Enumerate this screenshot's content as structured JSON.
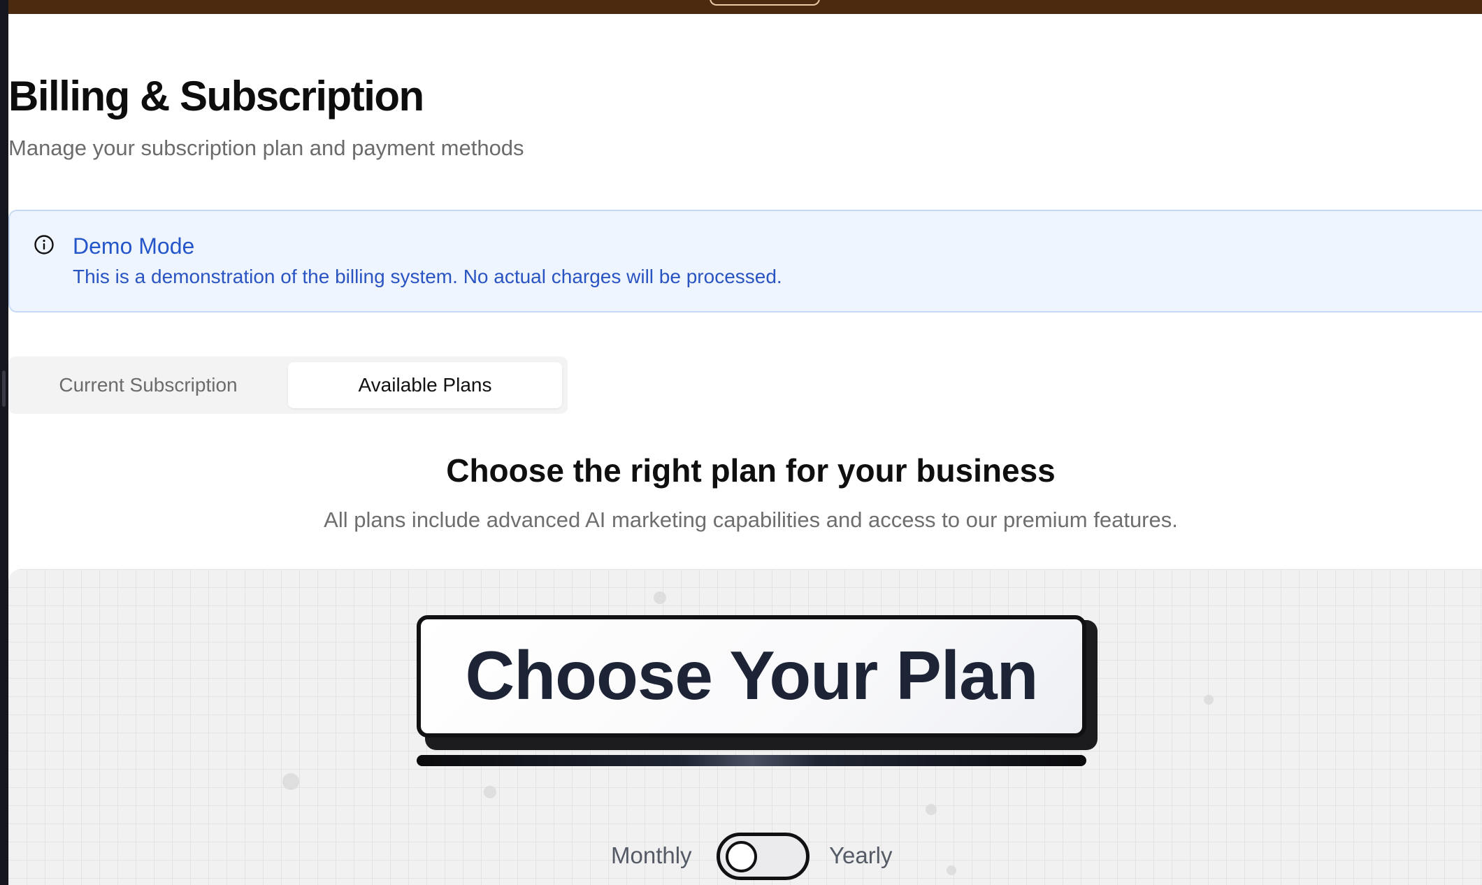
{
  "header": {
    "title": "Billing & Subscription",
    "subtitle": "Manage your subscription plan and payment methods"
  },
  "demo_banner": {
    "icon": "info-icon",
    "title": "Demo Mode",
    "message": "This is a demonstration of the billing system. No actual charges will be processed."
  },
  "tabs": {
    "current_subscription": "Current Subscription",
    "available_plans": "Available Plans",
    "active": "Available Plans"
  },
  "plans_section": {
    "heading": "Choose the right plan for your business",
    "description": "All plans include advanced AI marketing capabilities and access to our premium features.",
    "banner_title": "Choose Your Plan"
  },
  "billing_cycle": {
    "monthly_label": "Monthly",
    "yearly_label": "Yearly",
    "selected": "Monthly"
  },
  "colors": {
    "top_bar": "#4c2a0f",
    "banner_background": "#eff5fe",
    "banner_text": "#2456c9",
    "plan_title": "#1c2436"
  }
}
